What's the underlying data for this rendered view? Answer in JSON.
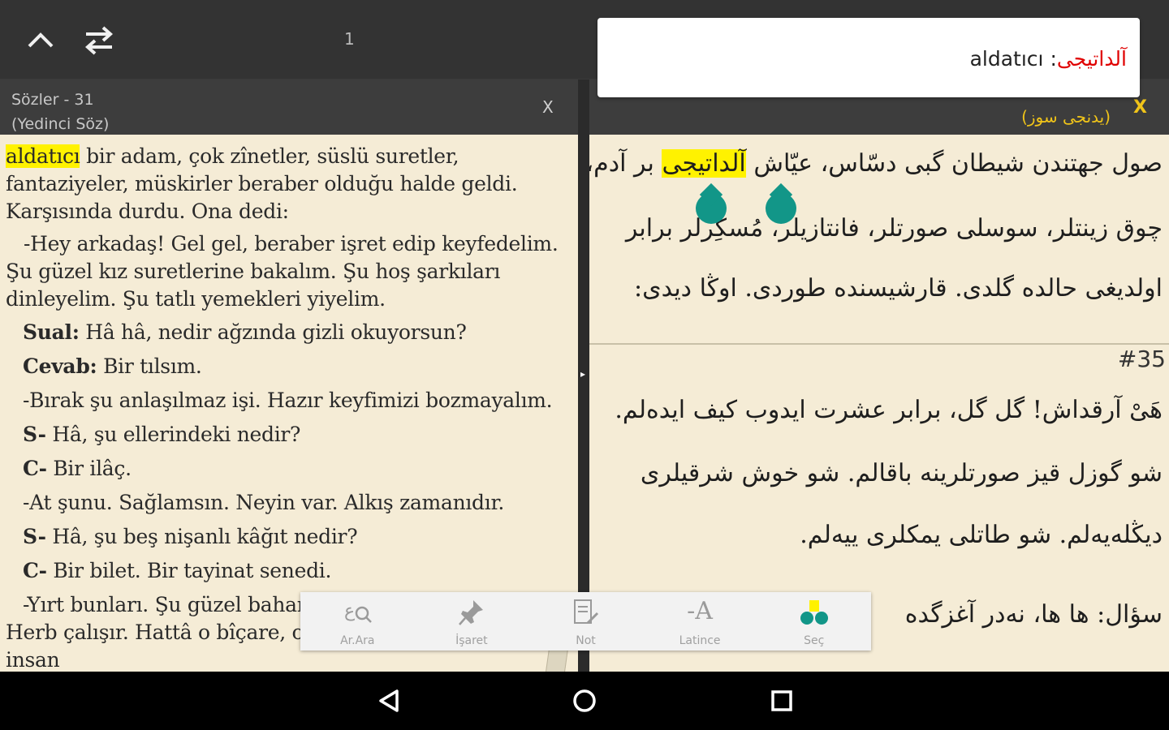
{
  "topbar": {
    "page_number": "1",
    "icons": [
      "chevron-up-icon",
      "swap-icon"
    ]
  },
  "popup": {
    "arabic": "آلداتيجى",
    "separator": ":",
    "latin": "aldatıcı"
  },
  "left_panel": {
    "title_line1": "Sözler - 31",
    "title_line2": "(Yedinci Söz)",
    "close_label": "X",
    "paragraphs": {
      "p1_highlight": "aldatıcı",
      "p1_rest": " bir adam, çok zînetler, süslü suretler, fantaziyeler, müskirler beraber olduğu halde geldi. Karşısında durdu. Ona dedi:",
      "p2": "-Hey arkadaş! Gel gel, beraber işret edip keyfedelim. Şu güzel kız suretlerine bakalım. Şu hoş şarkıları dinleyelim. Şu tatlı yemekleri yiyelim.",
      "p3_bold": "Sual:",
      "p3_rest": " Hâ hâ, nedir ağzında gizli okuyorsun?",
      "p4_bold": "Cevab:",
      "p4_rest": " Bir tılsım.",
      "p5": "-Bırak şu anlaşılmaz işi. Hazır keyfimizi bozmayalım.",
      "p6_bold": "S-",
      "p6_rest": " Hâ, şu ellerindeki nedir?",
      "p7_bold": "C-",
      "p7_rest": " Bir ilâç.",
      "p8": "-At şunu. Sağlamsın. Neyin var. Alkış zamanıdır.",
      "p9_bold": "S-",
      "p9_rest": " Hâ, şu beş nişanlı kâğıt nedir?",
      "p10_bold": "C-",
      "p10_rest": " Bir bilet. Bir tayinat senedi.",
      "p11": "-Yırt bunları. Şu güzel bahar bizim nemize lâzım! der. Herb çalışır. Hattâ o bîçare, ona biraz meyleder. Evet, insan"
    }
  },
  "right_panel": {
    "title": "(يدنجى سوز)",
    "close_label": "X",
    "lines": {
      "l1_pre": "صول جهتندن شيطان گبى دسّاس، عيّاش ",
      "l1_hl": "آلداتيجى",
      "l1_post": " بر آدم،",
      "l2": "چوق زينتلر، سوسلى صورتلر، فانتازيلر، مُسكِرلر برابر",
      "l3": "اولديغى حالده گلدى. قارشيسنده طوردى. اوڭا ديدى:",
      "number": "#35",
      "l4": "هَىْ آرقداش! گل گل، برابر عشرت ايدوب كيف ايده‌لم.",
      "l5": "شو گوزل قيز صورتلرينه باقالم. شو خوش شرقيلرى",
      "l6": "ديڭله‌يه‌لم. شو طاتلى يمكلرى ييه‌لم.",
      "l7": "سؤال: ها ها، نەدر آغزگده"
    }
  },
  "toolbar": {
    "items": [
      {
        "label": "Ar.Ara",
        "icon": "arabic-search-icon"
      },
      {
        "label": "İşaret",
        "icon": "pin-icon"
      },
      {
        "label": "Not",
        "icon": "note-icon"
      },
      {
        "label": "Latince",
        "icon": "latin-font-icon"
      },
      {
        "label": "Seç",
        "icon": "select-handles-icon"
      }
    ]
  },
  "navbar": {
    "icons": [
      "back-icon",
      "home-icon",
      "recents-icon"
    ]
  },
  "colors": {
    "page_bg": "#f5ecd6",
    "highlight": "#fff200",
    "handle": "#129688",
    "accent_yellow": "#f0c419",
    "popup_arabic": "#e00000"
  }
}
